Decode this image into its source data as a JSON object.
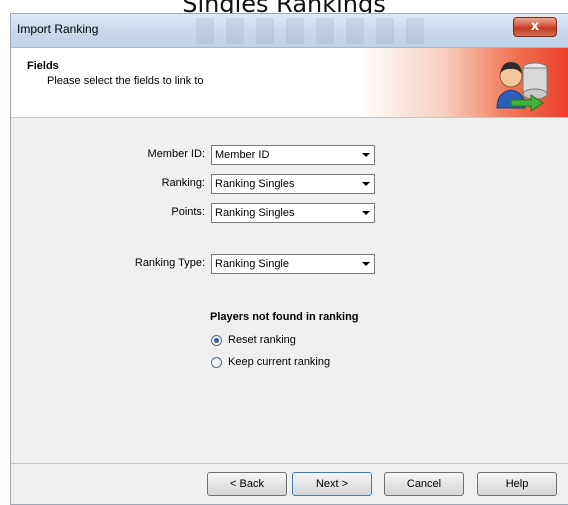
{
  "page_title": "Singles Rankings",
  "window": {
    "title": "Import Ranking",
    "close_label": "x"
  },
  "header": {
    "title": "Fields",
    "subtitle": "Please select the fields to link to"
  },
  "fields": [
    {
      "label": "Member ID:",
      "value": "Member ID"
    },
    {
      "label": "Ranking:",
      "value": "Ranking Singles"
    },
    {
      "label": "Points:",
      "value": "Ranking Singles"
    },
    {
      "label": "Ranking Type:",
      "value": "Ranking Single"
    }
  ],
  "not_found_group": {
    "title": "Players not found in ranking",
    "options": [
      {
        "label": "Reset ranking",
        "checked": true
      },
      {
        "label": "Keep current ranking",
        "checked": false
      }
    ]
  },
  "buttons": {
    "back": "< Back",
    "next": "Next >",
    "cancel": "Cancel",
    "help": "Help"
  },
  "icons": {
    "header_icon": "user-database-import-icon",
    "close_icon": "close-icon",
    "dropdown_icon": "chevron-down-icon"
  },
  "colors": {
    "close_button": "#c23a1d",
    "header_accent": "#e8402a",
    "dialog_bg": "#f0f0f0"
  }
}
